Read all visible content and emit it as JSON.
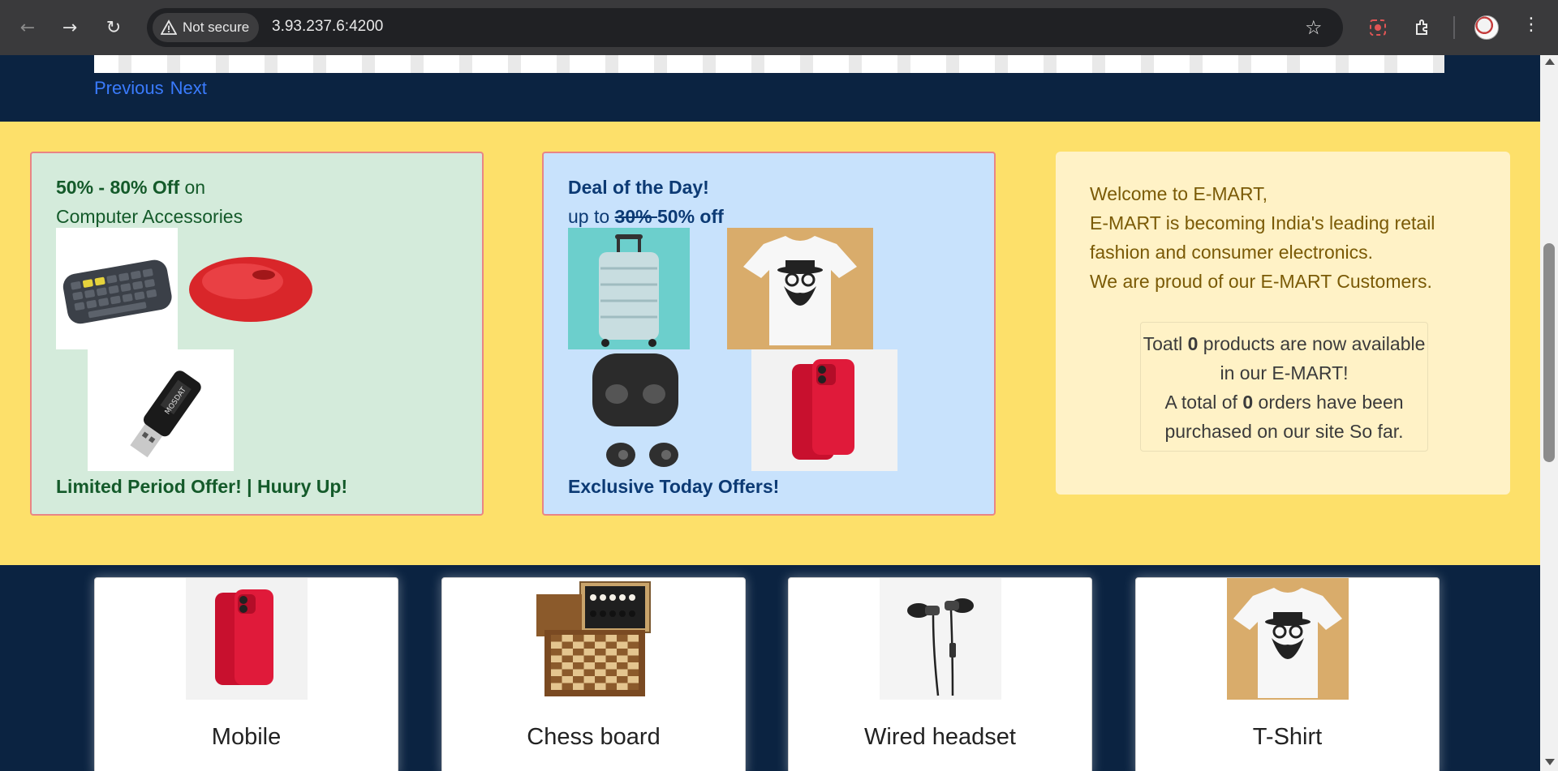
{
  "browser": {
    "security_label": "Not secure",
    "url": "3.93.237.6:4200"
  },
  "carousel": {
    "previous_label": "Previous",
    "next_label": "Next"
  },
  "offer_computer": {
    "headline_bold": "50% - 80% Off",
    "headline_rest": " on",
    "subline": "Computer Accessories",
    "footer": "Limited Period Offer! | Huury Up!"
  },
  "offer_deal": {
    "headline": "Deal of the Day!",
    "subline_prefix": "up to ",
    "old_discount": "30% ",
    "new_discount": "50% off",
    "footer": "Exclusive Today Offers!"
  },
  "welcome": {
    "line1": "Welcome to E-MART,",
    "line2": "E-MART is becoming India's leading retail fashion and consumer electronics.",
    "line3": "We are proud of our E-MART Customers."
  },
  "stats": {
    "products_prefix": "Toatl ",
    "products_count": "0",
    "products_suffix": " products are now available in our E-MART!",
    "orders_prefix": "A total of ",
    "orders_count": "0",
    "orders_suffix": " orders have been purchased on our site So far."
  },
  "products": [
    {
      "name": "Mobile",
      "icon": "red-smartphone"
    },
    {
      "name": "Chess board",
      "icon": "chess-board"
    },
    {
      "name": "Wired headset",
      "icon": "earphones"
    },
    {
      "name": "T-Shirt",
      "icon": "tshirt"
    }
  ],
  "colors": {
    "page_bg": "#0b2341",
    "offers_bg": "#fde06a",
    "green_card": "#d4ebdb",
    "blue_card": "#c8e2fc",
    "welcome_card": "#fff2c6",
    "link": "#3a7bfd"
  }
}
